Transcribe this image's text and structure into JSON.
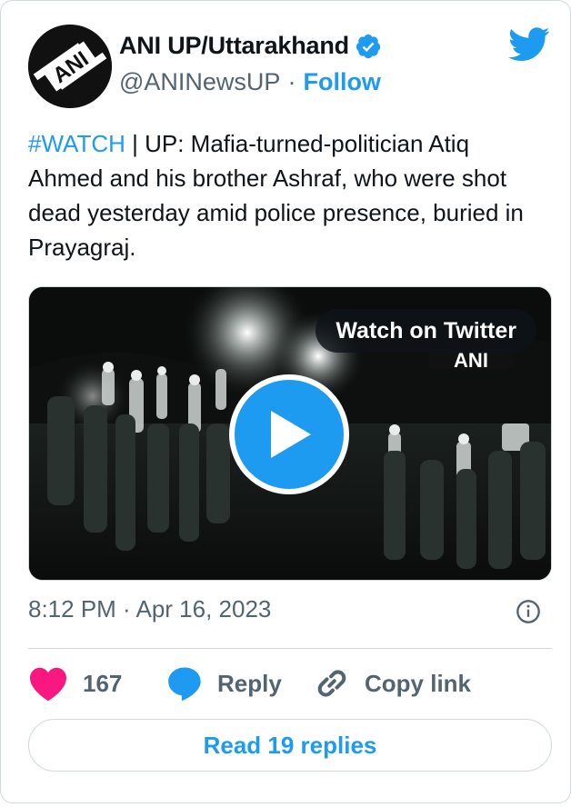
{
  "author": {
    "name": "ANI UP/Uttarakhand",
    "handle": "@ANINewsUP",
    "separator": "·",
    "follow_label": "Follow",
    "avatar_text": "ANI"
  },
  "tweet": {
    "hashtag": "#WATCH",
    "body": " | UP: Mafia-turned-politician Atiq Ahmed and his brother Ashraf, who were shot dead yesterday amid police presence, buried in Prayagraj."
  },
  "media": {
    "watch_label": "Watch on Twitter",
    "watermark": "ANI"
  },
  "meta": {
    "timestamp": "8:12 PM · Apr 16, 2023"
  },
  "actions": {
    "likes_count": "167",
    "reply_label": "Reply",
    "copy_link_label": "Copy link"
  },
  "footer": {
    "read_replies_label": "Read 19 replies"
  },
  "colors": {
    "accent": "#1d9bf0",
    "like": "#f91880",
    "secondary_text": "#536471"
  },
  "icons": [
    "verified-badge-icon",
    "twitter-bird-icon",
    "play-icon",
    "info-icon",
    "heart-icon",
    "reply-bubble-icon",
    "link-icon"
  ]
}
